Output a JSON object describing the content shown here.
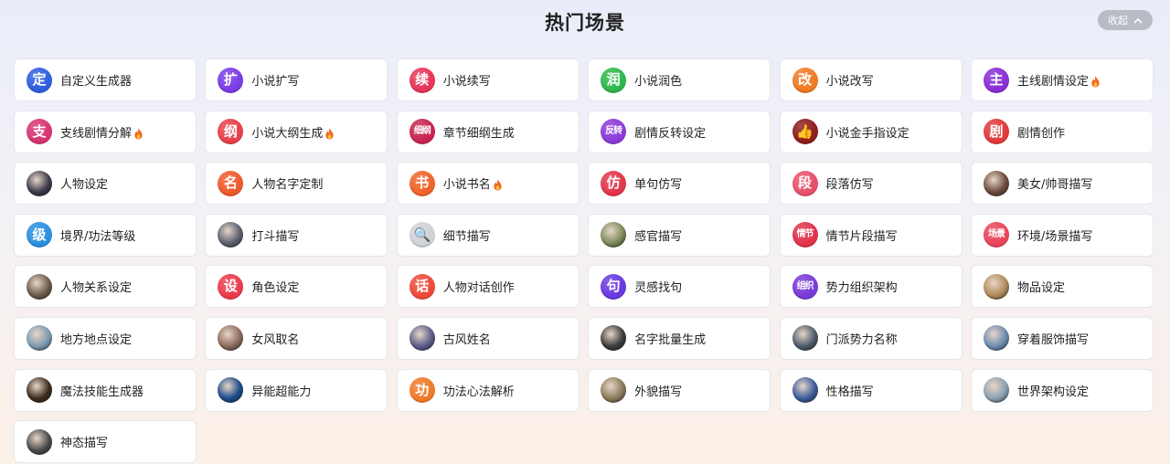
{
  "header": {
    "title": "热门场景",
    "collapse_label": "收起"
  },
  "colors": {
    "card_bg": "#ffffff",
    "hot_flame": "#f26a1b",
    "collapse_bg": "#b9bcc5"
  },
  "scenes": [
    {
      "label": "自定义生成器",
      "glyph": "定",
      "color": "#2f5fe0",
      "icon": "ding-badge-icon",
      "hot": false
    },
    {
      "label": "小说扩写",
      "glyph": "扩",
      "color": "#7a3ce6",
      "icon": "kuo-badge-icon",
      "hot": false
    },
    {
      "label": "小说续写",
      "glyph": "续",
      "color": "#e8365a",
      "icon": "xu-badge-icon",
      "hot": false
    },
    {
      "label": "小说润色",
      "glyph": "润",
      "color": "#2fb84a",
      "icon": "run-badge-icon",
      "hot": false
    },
    {
      "label": "小说改写",
      "glyph": "改",
      "color": "#f07a24",
      "icon": "gai-badge-icon",
      "hot": false
    },
    {
      "label": "主线剧情设定",
      "glyph": "主",
      "color": "#8a2fd6",
      "icon": "zhu-badge-icon",
      "hot": true
    },
    {
      "label": "支线剧情分解",
      "glyph": "支",
      "color": "#d83474",
      "icon": "zhi-badge-icon",
      "hot": true
    },
    {
      "label": "小说大纲生成",
      "glyph": "纲",
      "color": "#ea3f4a",
      "icon": "gang-badge-icon",
      "hot": true
    },
    {
      "label": "章节细纲生成",
      "glyph": "细纲",
      "color": "#c7254f",
      "icon": "xigang-badge-icon",
      "hot": false
    },
    {
      "label": "剧情反转设定",
      "glyph": "反转",
      "color": "#8b3ad8",
      "icon": "fanzhuan-badge-icon",
      "hot": false
    },
    {
      "label": "小说金手指设定",
      "glyph": "👍",
      "color": "#8f1d1d",
      "icon": "golden-finger-icon",
      "hot": false
    },
    {
      "label": "剧情创作",
      "glyph": "剧",
      "color": "#e23a3a",
      "icon": "ju-badge-icon",
      "hot": false
    },
    {
      "label": "人物设定",
      "glyph": "",
      "color": "#3a3a4a",
      "icon": "character-portrait-icon",
      "hot": false
    },
    {
      "label": "人物名字定制",
      "glyph": "名",
      "color": "#ef5a2c",
      "icon": "ming-badge-icon",
      "hot": false
    },
    {
      "label": "小说书名",
      "glyph": "书",
      "color": "#f0642a",
      "icon": "shu-badge-icon",
      "hot": true
    },
    {
      "label": "单句仿写",
      "glyph": "仿",
      "color": "#e3364c",
      "icon": "fang-badge-icon",
      "hot": false
    },
    {
      "label": "段落仿写",
      "glyph": "段",
      "color": "#e8506a",
      "icon": "duan-badge-icon",
      "hot": false
    },
    {
      "label": "美女/帅哥描写",
      "glyph": "",
      "color": "#6b4a3a",
      "icon": "portrait-photo-icon",
      "hot": false
    },
    {
      "label": "境界/功法等级",
      "glyph": "级",
      "color": "#2a8fe0",
      "icon": "ji-badge-icon",
      "hot": false
    },
    {
      "label": "打斗描写",
      "glyph": "",
      "color": "#5a6070",
      "icon": "fight-scene-icon",
      "hot": false
    },
    {
      "label": "细节描写",
      "glyph": "🔍",
      "color": "#cfd3d8",
      "icon": "magnifier-icon",
      "hot": false
    },
    {
      "label": "感官描写",
      "glyph": "",
      "color": "#7c8a5a",
      "icon": "senses-portrait-icon",
      "hot": false
    },
    {
      "label": "情节片段描写",
      "glyph": "情节",
      "color": "#e0334a",
      "icon": "qingjie-badge-icon",
      "hot": false
    },
    {
      "label": "环境/场景描写",
      "glyph": "场景",
      "color": "#e8455a",
      "icon": "changjing-badge-icon",
      "hot": false
    },
    {
      "label": "人物关系设定",
      "glyph": "",
      "color": "#6a5a4a",
      "icon": "couple-portrait-icon",
      "hot": false
    },
    {
      "label": "角色设定",
      "glyph": "设",
      "color": "#ec3a4c",
      "icon": "she-badge-icon",
      "hot": false
    },
    {
      "label": "人物对话创作",
      "glyph": "话",
      "color": "#ee4a3a",
      "icon": "hua-badge-icon",
      "hot": false
    },
    {
      "label": "灵感找句",
      "glyph": "句",
      "color": "#6a3ae0",
      "icon": "ju-sentence-badge-icon",
      "hot": false
    },
    {
      "label": "势力组织架构",
      "glyph": "组织",
      "color": "#7a3ad8",
      "icon": "zuzhi-badge-icon",
      "hot": false
    },
    {
      "label": "物品设定",
      "glyph": "",
      "color": "#b08a5a",
      "icon": "item-box-icon",
      "hot": false
    },
    {
      "label": "地方地点设定",
      "glyph": "",
      "color": "#7a9ab0",
      "icon": "location-photo-icon",
      "hot": false
    },
    {
      "label": "女风取名",
      "glyph": "",
      "color": "#8a6a5a",
      "icon": "female-portrait-icon",
      "hot": false
    },
    {
      "label": "古风姓名",
      "glyph": "",
      "color": "#5a5a8a",
      "icon": "ancient-portrait-icon",
      "hot": false
    },
    {
      "label": "名字批量生成",
      "glyph": "",
      "color": "#3a3a3a",
      "icon": "figure-portrait-icon",
      "hot": false
    },
    {
      "label": "门派势力名称",
      "glyph": "",
      "color": "#4a5a6a",
      "icon": "sect-portrait-icon",
      "hot": false
    },
    {
      "label": "穿着服饰描写",
      "glyph": "",
      "color": "#6a8ab0",
      "icon": "costume-figure-icon",
      "hot": false
    },
    {
      "label": "魔法技能生成器",
      "glyph": "",
      "color": "#3a2a1a",
      "icon": "magic-skill-icon",
      "hot": false
    },
    {
      "label": "异能超能力",
      "glyph": "",
      "color": "#1a4a8a",
      "icon": "superpower-orb-icon",
      "hot": false
    },
    {
      "label": "功法心法解析",
      "glyph": "功",
      "color": "#f07a2a",
      "icon": "gong-badge-icon",
      "hot": false
    },
    {
      "label": "外貌描写",
      "glyph": "",
      "color": "#8a7a5a",
      "icon": "appearance-portrait-icon",
      "hot": false
    },
    {
      "label": "性格描写",
      "glyph": "",
      "color": "#3a5a9a",
      "icon": "personality-portrait-icon",
      "hot": false
    },
    {
      "label": "世界架构设定",
      "glyph": "",
      "color": "#8aa0b0",
      "icon": "world-figure-icon",
      "hot": false
    },
    {
      "label": "神态描写",
      "glyph": "",
      "color": "#4a4a4a",
      "icon": "expression-portrait-icon",
      "hot": false
    }
  ]
}
